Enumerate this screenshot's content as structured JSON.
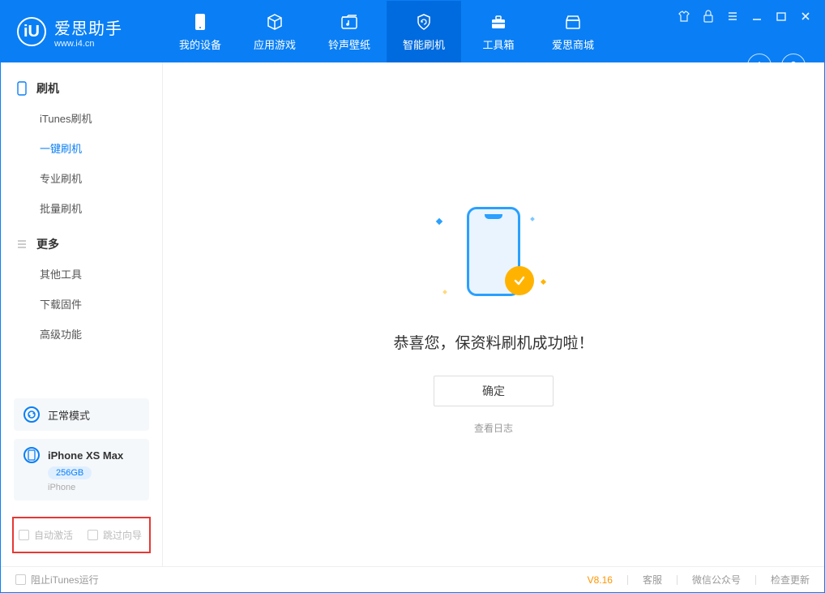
{
  "logo": {
    "main": "爱思助手",
    "sub": "www.i4.cn",
    "badge": "iU"
  },
  "tabs": [
    {
      "label": "我的设备"
    },
    {
      "label": "应用游戏"
    },
    {
      "label": "铃声壁纸"
    },
    {
      "label": "智能刷机"
    },
    {
      "label": "工具箱"
    },
    {
      "label": "爱思商城"
    }
  ],
  "sidebar": {
    "group1": {
      "title": "刷机",
      "items": [
        "iTunes刷机",
        "一键刷机",
        "专业刷机",
        "批量刷机"
      ]
    },
    "group2": {
      "title": "更多",
      "items": [
        "其他工具",
        "下载固件",
        "高级功能"
      ]
    },
    "mode_label": "正常模式",
    "device_name": "iPhone XS Max",
    "device_storage": "256GB",
    "device_type": "iPhone",
    "auto_activate": "自动激活",
    "skip_guide": "跳过向导"
  },
  "main": {
    "success_title": "恭喜您，保资料刷机成功啦！",
    "ok_btn": "确定",
    "log_link": "查看日志"
  },
  "footer": {
    "block_itunes": "阻止iTunes运行",
    "version": "V8.16",
    "support": "客服",
    "wechat": "微信公众号",
    "update": "检查更新"
  }
}
